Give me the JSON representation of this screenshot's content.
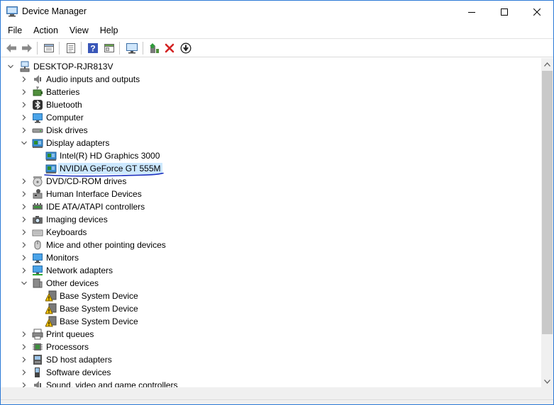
{
  "window": {
    "title": "Device Manager"
  },
  "window_buttons": {
    "minimize": "minimize",
    "maximize": "maximize",
    "close": "close"
  },
  "menu": [
    "File",
    "Action",
    "View",
    "Help"
  ],
  "toolbar": [
    "back-arrow-icon",
    "forward-arrow-icon",
    "properties-icon",
    "properties-sheet-icon",
    "help-icon",
    "view-icon",
    "scan-monitor-icon",
    "update-driver-icon",
    "uninstall-icon",
    "disable-icon"
  ],
  "tree": {
    "root": "DESKTOP-RJR813V",
    "categories": [
      {
        "label": "Audio inputs and outputs",
        "icon": "speaker-icon",
        "expanded": false
      },
      {
        "label": "Batteries",
        "icon": "battery-icon",
        "expanded": false
      },
      {
        "label": "Bluetooth",
        "icon": "bluetooth-icon",
        "expanded": false
      },
      {
        "label": "Computer",
        "icon": "monitor-icon",
        "expanded": false
      },
      {
        "label": "Disk drives",
        "icon": "disk-icon",
        "expanded": false
      },
      {
        "label": "Display adapters",
        "icon": "display-adapter-icon",
        "expanded": true,
        "children": [
          {
            "label": "Intel(R) HD Graphics 3000",
            "icon": "display-adapter-icon",
            "selected": false
          },
          {
            "label": "NVIDIA GeForce GT 555M",
            "icon": "display-adapter-icon",
            "selected": true
          }
        ]
      },
      {
        "label": "DVD/CD-ROM drives",
        "icon": "dvd-icon",
        "expanded": false
      },
      {
        "label": "Human Interface Devices",
        "icon": "hid-icon",
        "expanded": false
      },
      {
        "label": "IDE ATA/ATAPI controllers",
        "icon": "ide-icon",
        "expanded": false
      },
      {
        "label": "Imaging devices",
        "icon": "camera-icon",
        "expanded": false
      },
      {
        "label": "Keyboards",
        "icon": "keyboard-icon",
        "expanded": false
      },
      {
        "label": "Mice and other pointing devices",
        "icon": "mouse-icon",
        "expanded": false
      },
      {
        "label": "Monitors",
        "icon": "monitor-icon",
        "expanded": false
      },
      {
        "label": "Network adapters",
        "icon": "network-icon",
        "expanded": false
      },
      {
        "label": "Other devices",
        "icon": "other-devices-icon",
        "expanded": true,
        "children": [
          {
            "label": "Base System Device",
            "icon": "warning-device-icon",
            "selected": false
          },
          {
            "label": "Base System Device",
            "icon": "warning-device-icon",
            "selected": false
          },
          {
            "label": "Base System Device",
            "icon": "warning-device-icon",
            "selected": false
          }
        ]
      },
      {
        "label": "Print queues",
        "icon": "printer-icon",
        "expanded": false
      },
      {
        "label": "Processors",
        "icon": "processor-icon",
        "expanded": false
      },
      {
        "label": "SD host adapters",
        "icon": "sd-icon",
        "expanded": false
      },
      {
        "label": "Software devices",
        "icon": "software-icon",
        "expanded": false
      },
      {
        "label": "Sound, video and game controllers",
        "icon": "speaker-icon",
        "expanded": false
      }
    ]
  },
  "colors": {
    "selection": "#cce8ff",
    "window_border": "#2b79d6",
    "annotation": "#1a2fbf"
  }
}
